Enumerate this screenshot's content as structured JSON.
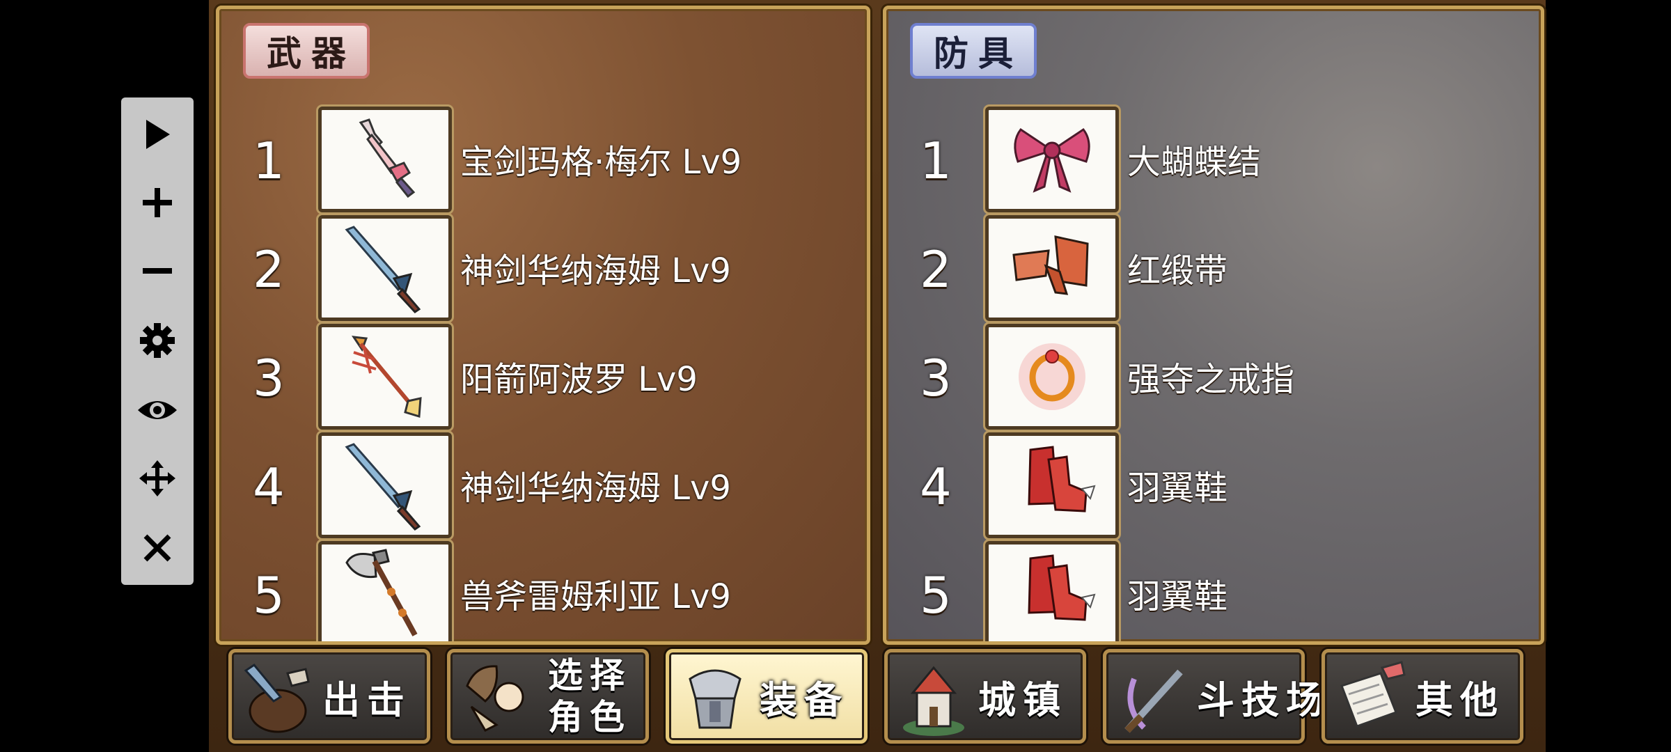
{
  "toolbar": {
    "play_icon": "play-icon",
    "zoom_in_icon": "plus-icon",
    "zoom_out_icon": "minus-icon",
    "settings_icon": "gear-icon",
    "visibility_icon": "eye-icon",
    "move_icon": "move-icon",
    "close_icon": "close-icon"
  },
  "weapons": {
    "title": "武器",
    "items": [
      {
        "number": "1",
        "name": "宝剑玛格·梅尔 Lv9",
        "icon": "pink-sword-icon"
      },
      {
        "number": "2",
        "name": "神剑华纳海姆 Lv9",
        "icon": "blue-sword-icon"
      },
      {
        "number": "3",
        "name": "阳箭阿波罗 Lv9",
        "icon": "arrow-icon"
      },
      {
        "number": "4",
        "name": "神剑华纳海姆 Lv9",
        "icon": "blue-sword-icon"
      },
      {
        "number": "5",
        "name": "兽斧雷姆利亚 Lv9",
        "icon": "axe-icon"
      }
    ]
  },
  "armor": {
    "title": "防具",
    "items": [
      {
        "number": "1",
        "name": "大蝴蝶结",
        "icon": "bow-ribbon-icon"
      },
      {
        "number": "2",
        "name": "红缎带",
        "icon": "red-ribbon-icon"
      },
      {
        "number": "3",
        "name": "强夺之戒指",
        "icon": "ring-icon"
      },
      {
        "number": "4",
        "name": "羽翼鞋",
        "icon": "winged-boots-icon"
      },
      {
        "number": "5",
        "name": "羽翼鞋",
        "icon": "winged-boots-icon"
      }
    ]
  },
  "nav": {
    "sortie": "出击",
    "select_line1": "选择",
    "select_line2": "角色",
    "equipment": "装备",
    "town": "城镇",
    "arena": "斗技场",
    "other": "其他",
    "active": "equipment"
  },
  "colors": {
    "weapon_panel": "#7e5232",
    "armor_panel": "#6f6c6e",
    "frame_gold": "#c8a35a",
    "toolbar_bg": "#c7c7c7"
  }
}
